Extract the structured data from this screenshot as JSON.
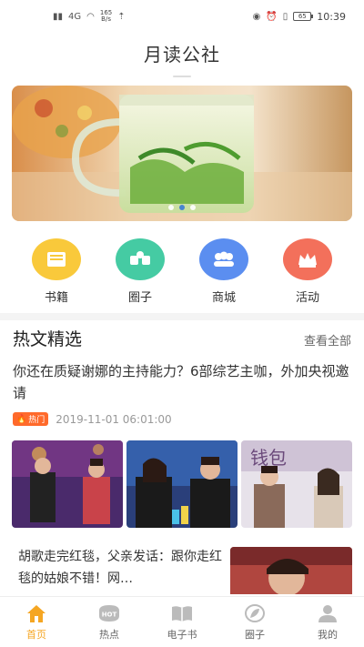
{
  "status_bar": {
    "carrier": "4G",
    "speed_value": "165",
    "speed_unit": "B/s",
    "battery": "65",
    "time": "10:39"
  },
  "header": {
    "title": "月读公社"
  },
  "banner": {
    "slide_count": 3,
    "active_index": 1,
    "active_dot_color": "#3a7bd5"
  },
  "categories": [
    {
      "label": "书籍",
      "icon": "book-icon",
      "color": "#f9c93b"
    },
    {
      "label": "圈子",
      "icon": "circle-group-icon",
      "color": "#45cba3"
    },
    {
      "label": "商城",
      "icon": "people-icon",
      "color": "#5b8ef0"
    },
    {
      "label": "活动",
      "icon": "crown-icon",
      "color": "#f3705b"
    }
  ],
  "section": {
    "title": "热文精选",
    "see_all": "查看全部"
  },
  "article1": {
    "title": "你还在质疑谢娜的主持能力？6部综艺主咖，外加央视邀请",
    "badge": "热门",
    "timestamp": "2019-11-01 06:01:00"
  },
  "article2": {
    "title": "胡歌走完红毯，父亲发话：跟你走红毯的姑娘不错！网…"
  },
  "bottom_nav": [
    {
      "label": "首页",
      "icon": "home-icon",
      "active": true
    },
    {
      "label": "热点",
      "icon": "hot-icon",
      "active": false
    },
    {
      "label": "电子书",
      "icon": "ebook-icon",
      "active": false
    },
    {
      "label": "圈子",
      "icon": "leaf-icon",
      "active": false
    },
    {
      "label": "我的",
      "icon": "user-icon",
      "active": false
    }
  ],
  "colors": {
    "accent": "#f5a623",
    "hot_badge": "#ff6a2b"
  }
}
